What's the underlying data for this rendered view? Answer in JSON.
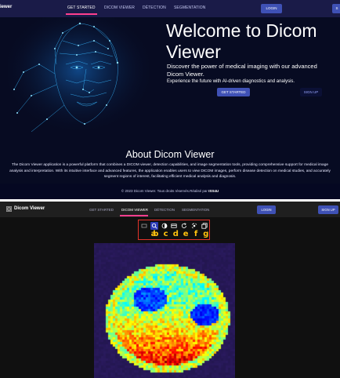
{
  "landing": {
    "brand": "iewer",
    "nav_tabs": [
      "GET STARTED",
      "DICOM VIEWER",
      "DÉTECTION",
      "SEGMENTATION"
    ],
    "active_tab": "GET STARTED",
    "login_label": "LOGIN",
    "signup_label": "S",
    "hero": {
      "title": "Welcome to Dicom Viewer",
      "subtitle": "Discover the power of medical imaging with our advanced Dicom Viewer.",
      "subtitle2": "Experience the future with AI-driven diagnostics and analysis.",
      "get_started_label": "GET STARTED",
      "signup_label": "SIGN UP"
    },
    "about": {
      "title": "About Dicom Viewer",
      "text": "The Dicom Viewer application is a powerful platform that combines a DICOM viewer, detection capabilities, and image segmentation tools, providing comprehensive support for medical image analysis and interpretation. With its intuitive interface and advanced features, the application enables users to view DICOM images, perform disease detection on medical studies, and accurately segment regions of interest, facilitating efficient medical analysis and diagnosis."
    },
    "footer": {
      "text": "© 2023 Dicom Viewer. Tous droits réservés.Réalisé par ",
      "author": "ISS4U"
    }
  },
  "viewer": {
    "brand": "Dicom Viewer",
    "nav_tabs": [
      "GET STARTED",
      "DICOM VIEWER",
      "DÉTECTION",
      "SEGMENTATION"
    ],
    "active_tab": "DICOM VIEWER",
    "login_label": "LOGIN",
    "signup_label": "SIGN UP",
    "toolbar": {
      "tools": [
        {
          "icon": "image-icon",
          "letter": "a"
        },
        {
          "icon": "zoom-icon",
          "letter": "b"
        },
        {
          "icon": "contrast-icon",
          "letter": "c"
        },
        {
          "icon": "rectangle-icon",
          "letter": "d"
        },
        {
          "icon": "rotate-icon",
          "letter": "e"
        },
        {
          "icon": "pan-icon",
          "letter": "f"
        },
        {
          "icon": "layers-icon",
          "letter": "g"
        }
      ],
      "active_index": 1,
      "highlight_color": "#e2332a",
      "letter_color": "#ffc20e"
    }
  },
  "colors": {
    "landing_bg": "#070b22",
    "nav_bg": "#1a1b48",
    "accent": "#3f51b5",
    "tab_indicator": "#ff3f8e",
    "viewer_bg": "#101010"
  }
}
